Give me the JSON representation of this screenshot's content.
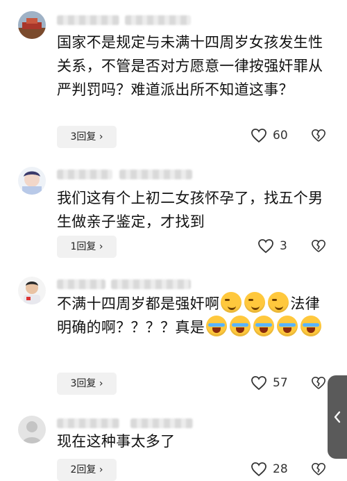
{
  "comments": [
    {
      "text": "国家不是规定与未满十四周岁女孩发生性关系，不管是否对方愿意一律按强奸罪从严判罚吗？难道派出所不知道这事？",
      "reply_label": "3回复",
      "likes": "60"
    },
    {
      "text": "我们这有个上初二女孩怀孕了，找五个男生做亲子鉴定，才找到",
      "reply_label": "1回复",
      "likes": "3"
    },
    {
      "text_a": "不满十四周岁都是强奸啊",
      "text_b": "法律明确的啊？？？？真是",
      "reply_label": "3回复",
      "likes": "57"
    },
    {
      "text": "现在这种事太多了",
      "reply_label": "2回复",
      "likes": "28"
    }
  ],
  "icons": {
    "like": "heart-icon",
    "dislike": "broken-heart-icon",
    "reply_arrow": "chevron-right-icon",
    "side": "chevron-left-icon"
  }
}
